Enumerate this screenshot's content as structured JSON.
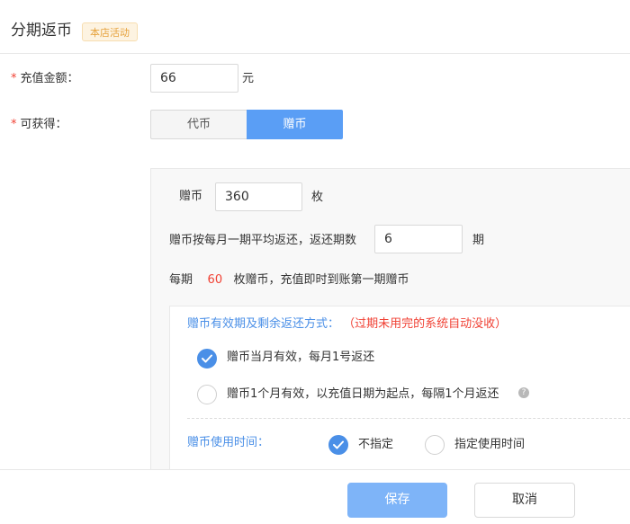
{
  "header": {
    "title": "分期返币",
    "badge": "本店活动"
  },
  "form": {
    "amount": {
      "required_mark": "*",
      "label": "充值金额：",
      "value": "66",
      "unit": "元"
    },
    "obtain": {
      "required_mark": "*",
      "label": "可获得：",
      "options": [
        "代币",
        "赠币"
      ],
      "selected": "赠币"
    }
  },
  "panel": {
    "coins": {
      "label": "赠币",
      "value": "360",
      "unit": "枚"
    },
    "periods": {
      "label": "赠币按每月一期平均返还，返还期数",
      "value": "6",
      "unit": "期"
    },
    "summary": {
      "prefix": "每期",
      "amount": "60",
      "suffix": "枚赠币，充值即时到账第一期赠币"
    },
    "validity": {
      "title": "赠币有效期及剩余返还方式：",
      "note": "（过期未用完的系统自动没收）",
      "options": [
        {
          "label": "赠币当月有效，每月1号返还",
          "checked": true
        },
        {
          "label": "赠币1个月有效，以充值日期为起点，每隔1个月返还",
          "checked": false
        }
      ],
      "help": "?"
    },
    "usage_time": {
      "title": "赠币使用时间：",
      "options": [
        {
          "label": "不指定",
          "checked": true
        },
        {
          "label": "指定使用时间",
          "checked": false
        }
      ]
    }
  },
  "footer": {
    "save_label": "保存",
    "cancel_label": "取消"
  },
  "colors": {
    "primary": "#5a9ef5",
    "required": "#f04134",
    "badge_text": "#e6a23c",
    "label_blue": "#4a8fe7"
  },
  "icons": {
    "checked_radio": "check-icon",
    "help": "question-icon"
  }
}
